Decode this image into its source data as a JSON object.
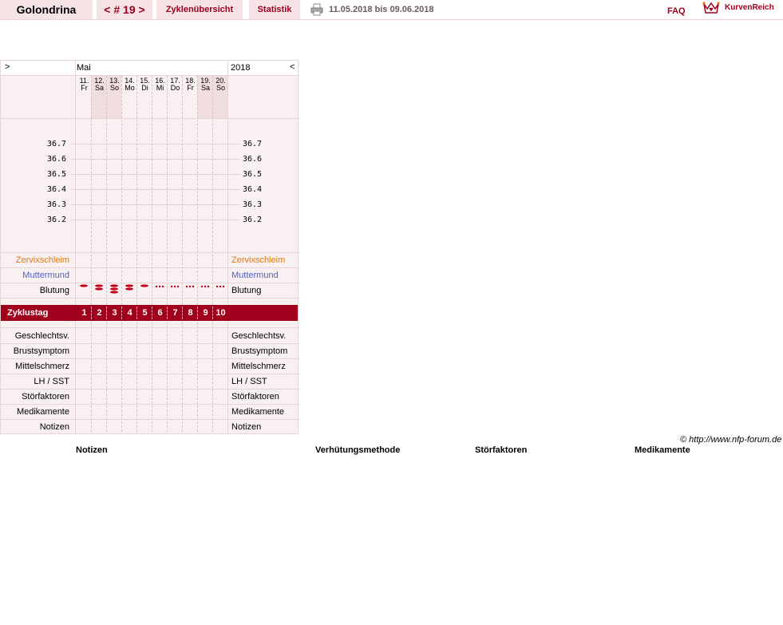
{
  "topbar": {
    "user": "Golondrina",
    "cycle_nav": "< # 19 >",
    "overview_tab": "Zyklenübersicht",
    "stats_tab": "Statistik",
    "date_range": "11.05.2018 bis 09.06.2018",
    "faq": "FAQ",
    "logo": "KurvenReich",
    "print_icon": "printer-icon",
    "logo_icon": "crown-heart-icon"
  },
  "chart": {
    "nav_next": ">",
    "nav_prev": "<",
    "month": "Mai",
    "year": "2018",
    "days": [
      {
        "num": "11.",
        "wd": "Fr"
      },
      {
        "num": "12.",
        "wd": "Sa"
      },
      {
        "num": "13.",
        "wd": "So"
      },
      {
        "num": "14.",
        "wd": "Mo"
      },
      {
        "num": "15.",
        "wd": "Di"
      },
      {
        "num": "16.",
        "wd": "Mi"
      },
      {
        "num": "17.",
        "wd": "Do"
      },
      {
        "num": "18.",
        "wd": "Fr"
      },
      {
        "num": "19.",
        "wd": "Sa"
      },
      {
        "num": "20.",
        "wd": "So"
      }
    ],
    "temps": [
      "36.7",
      "36.6",
      "36.5",
      "36.4",
      "36.3",
      "36.2"
    ],
    "rows": {
      "cervix": "Zervixschleim",
      "cervix_pos": "Muttermund",
      "bleeding": "Blutung",
      "cycle_day": "Zyklustag",
      "sex": "Geschlechtsv.",
      "breast": "Brustsymptom",
      "midpain": "Mittelschmerz",
      "lh": "LH / SST",
      "disturb": "Störfaktoren",
      "meds": "Medikamente",
      "notes": "Notizen"
    },
    "cycle_days": [
      "1",
      "2",
      "3",
      "4",
      "5",
      "6",
      "7",
      "8",
      "9",
      "10"
    ],
    "bleeding": [
      "medium",
      "heavy",
      "very-heavy",
      "heavy",
      "medium",
      "spotting",
      "spotting",
      "spotting",
      "spotting",
      "spotting"
    ],
    "colors": {
      "accent": "#a0001c",
      "cervix": "#e07a10",
      "cervix_pos": "#5060c0"
    }
  },
  "footer": {
    "copyright": "© http://www.nfp-forum.de",
    "notes": "Notizen",
    "contraception": "Verhütungsmethode",
    "disturb": "Störfaktoren",
    "meds": "Medikamente"
  }
}
